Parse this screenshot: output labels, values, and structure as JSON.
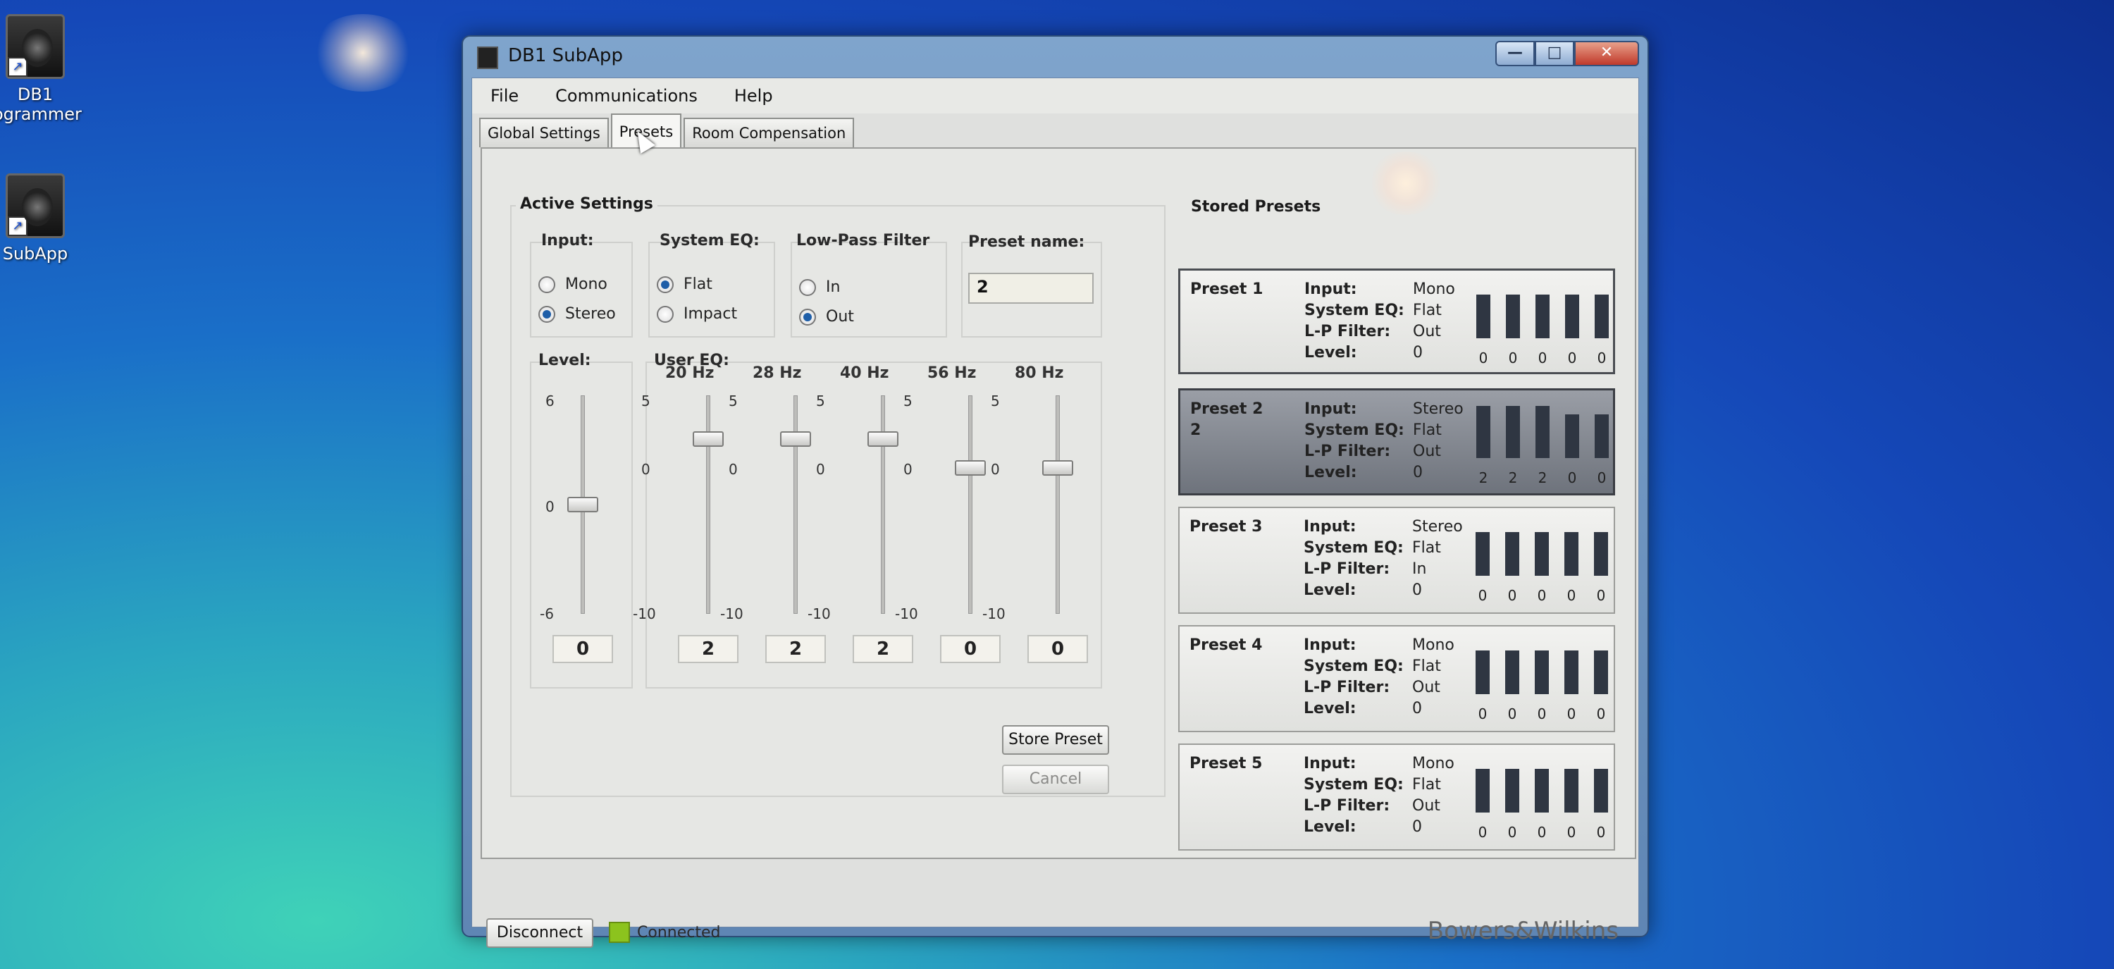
{
  "desktop": {
    "icons": [
      {
        "label_line1": "DB1",
        "label_line2": "ogrammer"
      },
      {
        "label_line1": "SubApp",
        "label_line2": ""
      }
    ]
  },
  "window": {
    "title": "DB1 SubApp",
    "controls": {
      "minimize": "—",
      "maximize": "□",
      "close": "✕"
    }
  },
  "menu": {
    "file": "File",
    "communications": "Communications",
    "help": "Help"
  },
  "tabs": {
    "global_settings": "Global Settings",
    "presets": "Presets",
    "room_compensation": "Room Compensation"
  },
  "active_settings": {
    "title": "Active Settings",
    "input": {
      "label": "Input:",
      "options": [
        "Mono",
        "Stereo"
      ],
      "selected": "Stereo"
    },
    "system_eq": {
      "label": "System EQ:",
      "options": [
        "Flat",
        "Impact"
      ],
      "selected": "Flat"
    },
    "low_pass": {
      "label": "Low-Pass Filter",
      "options": [
        "In",
        "Out"
      ],
      "selected": "Out"
    },
    "preset_name": {
      "label": "Preset name:",
      "value": "2"
    },
    "level": {
      "label": "Level:",
      "scale_top": "6",
      "scale_mid": "0",
      "scale_bottom": "-6",
      "value": "0",
      "value_num": 0,
      "min": -6,
      "max": 6
    },
    "user_eq": {
      "label": "User EQ:",
      "scale_top": "5",
      "scale_mid": "0",
      "scale_bottom": "-10",
      "min": -10,
      "max": 5,
      "bands": [
        {
          "freq": "20 Hz",
          "value": "2",
          "value_num": 2
        },
        {
          "freq": "28 Hz",
          "value": "2",
          "value_num": 2
        },
        {
          "freq": "40 Hz",
          "value": "2",
          "value_num": 2
        },
        {
          "freq": "56 Hz",
          "value": "0",
          "value_num": 0
        },
        {
          "freq": "80 Hz",
          "value": "0",
          "value_num": 0
        }
      ]
    },
    "store_button": "Store Preset",
    "cancel_button": "Cancel"
  },
  "stored_presets": {
    "title": "Stored Presets",
    "keys": {
      "input": "Input:",
      "system_eq": "System EQ:",
      "lp_filter": "L-P Filter:",
      "level": "Level:"
    },
    "items": [
      {
        "name": "Preset 1",
        "sub": "",
        "input": "Mono",
        "system_eq": "Flat",
        "lp_filter": "Out",
        "level": "0",
        "eq": [
          "0",
          "0",
          "0",
          "0",
          "0"
        ],
        "eq_num": [
          0,
          0,
          0,
          0,
          0
        ]
      },
      {
        "name": "Preset 2",
        "sub": "2",
        "input": "Stereo",
        "system_eq": "Flat",
        "lp_filter": "Out",
        "level": "0",
        "eq": [
          "2",
          "2",
          "2",
          "0",
          "0"
        ],
        "eq_num": [
          2,
          2,
          2,
          0,
          0
        ]
      },
      {
        "name": "Preset 3",
        "sub": "",
        "input": "Stereo",
        "system_eq": "Flat",
        "lp_filter": "In",
        "level": "0",
        "eq": [
          "0",
          "0",
          "0",
          "0",
          "0"
        ],
        "eq_num": [
          0,
          0,
          0,
          0,
          0
        ]
      },
      {
        "name": "Preset 4",
        "sub": "",
        "input": "Mono",
        "system_eq": "Flat",
        "lp_filter": "Out",
        "level": "0",
        "eq": [
          "0",
          "0",
          "0",
          "0",
          "0"
        ],
        "eq_num": [
          0,
          0,
          0,
          0,
          0
        ]
      },
      {
        "name": "Preset 5",
        "sub": "",
        "input": "Mono",
        "system_eq": "Flat",
        "lp_filter": "Out",
        "level": "0",
        "eq": [
          "0",
          "0",
          "0",
          "0",
          "0"
        ],
        "eq_num": [
          0,
          0,
          0,
          0,
          0
        ]
      }
    ]
  },
  "status": {
    "disconnect_button": "Disconnect",
    "connection": "Connected",
    "led_color": "#8cc31e",
    "brand": "Bowers&Wilkins"
  }
}
